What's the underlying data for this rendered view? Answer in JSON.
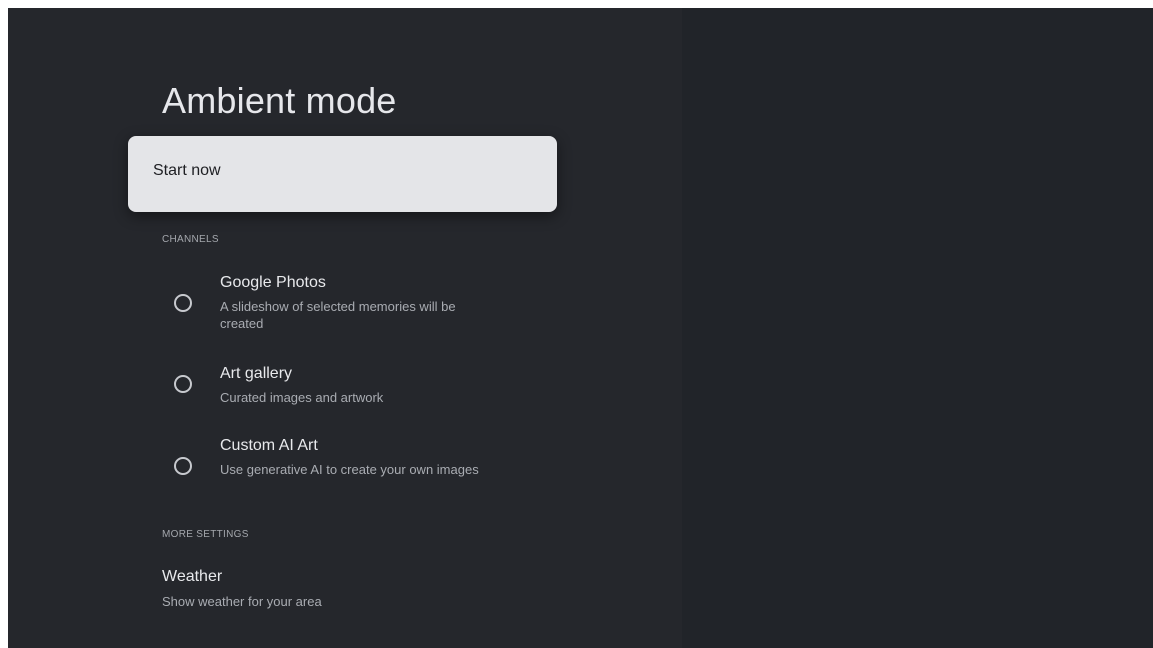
{
  "page": {
    "title": "Ambient mode"
  },
  "start": {
    "label": "Start now"
  },
  "channels": {
    "header": "CHANNELS",
    "items": [
      {
        "title": "Google Photos",
        "description": "A slideshow of selected memories will be created",
        "selected": false
      },
      {
        "title": "Art gallery",
        "description": "Curated images and artwork",
        "selected": false
      },
      {
        "title": "Custom AI Art",
        "description": "Use generative AI to create your own images",
        "selected": false
      }
    ]
  },
  "more_settings": {
    "header": "MORE SETTINGS",
    "items": [
      {
        "title": "Weather",
        "description": "Show weather for your area"
      }
    ]
  },
  "colors": {
    "background": "#202227",
    "panel": "#25272c",
    "focused_card": "#e4e5e8",
    "primary_text": "#e8e9ec",
    "secondary_text": "#a9acb2"
  },
  "icons": {
    "radio": "radio-unselected-icon"
  }
}
